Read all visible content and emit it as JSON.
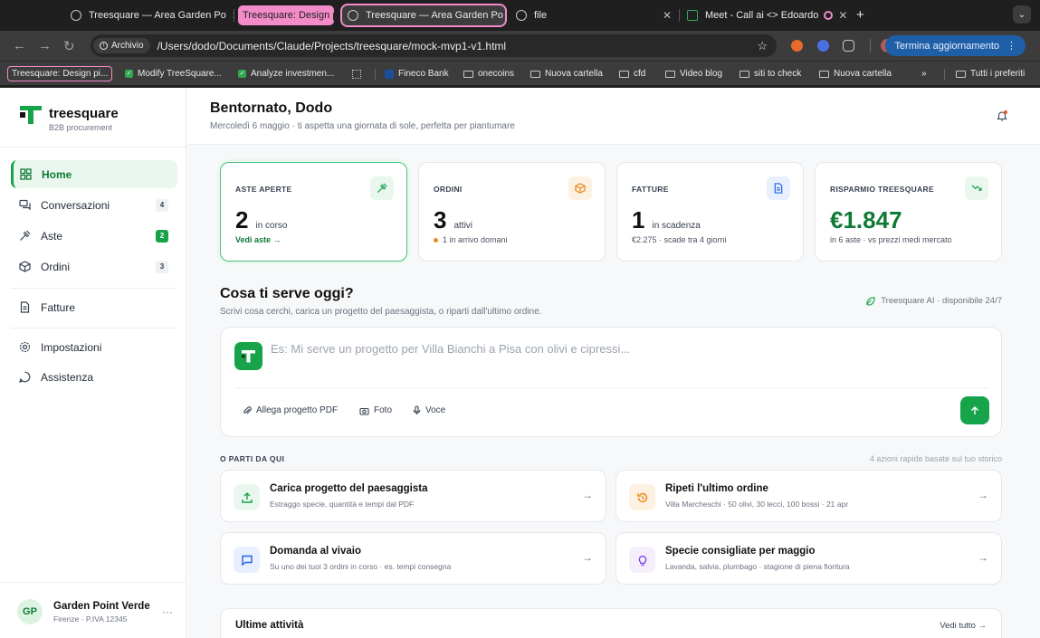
{
  "browser": {
    "tabs": [
      {
        "title": "Treesquare — Area Garden Po"
      },
      {
        "title": "Treesquare: Design p",
        "group": true
      },
      {
        "title": "Treesquare — Area Garden Po",
        "active": true
      },
      {
        "title": "file"
      },
      {
        "title": "Meet - Call ai <> Edoardo"
      }
    ],
    "url_chip": "Archivio",
    "url": "/Users/dodo/Documents/Claude/Projects/treesquare/mock-mvp1-v1.html",
    "update_label": "Termina aggiornamento",
    "bookmarks": [
      {
        "label": "Treesquare: Design pi...",
        "kind": "group"
      },
      {
        "label": "Modify TreeSquare...",
        "kind": "check"
      },
      {
        "label": "Analyze investmen...",
        "kind": "check"
      },
      {
        "label": "Fineco Bank",
        "kind": "site"
      },
      {
        "label": "onecoins",
        "kind": "folder"
      },
      {
        "label": "Nuova cartella",
        "kind": "folder"
      },
      {
        "label": "cfd",
        "kind": "folder"
      },
      {
        "label": "Video blog",
        "kind": "folder"
      },
      {
        "label": "siti to check",
        "kind": "folder"
      },
      {
        "label": "Nuova cartella",
        "kind": "folder"
      },
      {
        "label": "Tutti i preferiti",
        "kind": "folder"
      }
    ]
  },
  "sidebar": {
    "brand": "treesquare",
    "tagline": "B2B procurement",
    "items": [
      {
        "label": "Home",
        "icon": "grid-icon",
        "active": true
      },
      {
        "label": "Conversazioni",
        "icon": "chat-icon",
        "badge": "4"
      },
      {
        "label": "Aste",
        "icon": "gavel-icon",
        "badge": "2",
        "badge_green": true
      },
      {
        "label": "Ordini",
        "icon": "box-icon",
        "badge": "3"
      },
      {
        "label": "Fatture",
        "icon": "document-icon"
      },
      {
        "label": "Impostazioni",
        "icon": "gear-icon"
      },
      {
        "label": "Assistenza",
        "icon": "help-icon"
      }
    ],
    "user": {
      "initials": "GP",
      "name": "Garden Point Verde",
      "sub": "Firenze · P.IVA 12345"
    }
  },
  "header": {
    "title": "Bentornato, Dodo",
    "subtitle": "Mercoledì 6 maggio · ti aspetta una giornata di sole, perfetta per piantumare"
  },
  "stats": [
    {
      "label": "ASTE APERTE",
      "value": "2",
      "unit": "in corso",
      "foot": "Vedi aste →",
      "accent": "#16a34a"
    },
    {
      "label": "ORDINI",
      "value": "3",
      "unit": "attivi",
      "foot": "1 in arrivo domani",
      "accent": "#ea8a1a"
    },
    {
      "label": "FATTURE",
      "value": "1",
      "unit": "in scadenza",
      "foot": "€2.275 · scade tra 4 giorni",
      "accent": "#2563eb"
    },
    {
      "label": "RISPARMIO TREESQUARE",
      "value": "€1.847",
      "unit": "",
      "foot": "in 6 aste · vs prezzi medi mercato",
      "accent": "#16a34a"
    }
  ],
  "composer": {
    "title": "Cosa ti serve oggi?",
    "subtitle": "Scrivi cosa cerchi, carica un progetto del paesaggista, o riparti dall'ultimo ordine.",
    "ai_status": "Treesquare AI · disponibile 24/7",
    "placeholder": "Es: Mi serve un progetto per Villa Bianchi a Pisa con olivi e cipressi...",
    "attach_pdf": "Allega progetto PDF",
    "photo": "Foto",
    "voice": "Voce"
  },
  "quick": {
    "label": "O PARTI DA QUI",
    "note": "4 azioni rapide basate sul tuo storico",
    "items": [
      {
        "title": "Carica progetto del paesaggista",
        "sub": "Estraggo specie, quantità e tempi dal PDF",
        "icon": "upload-icon"
      },
      {
        "title": "Ripeti l'ultimo ordine",
        "sub": "Villa Marcheschi · 50 olivi, 30 lecci, 100 bossi · 21 apr",
        "icon": "history-icon"
      },
      {
        "title": "Domanda al vivaio",
        "sub": "Su uno dei tuoi 3 ordini in corso · es. tempi consegna",
        "icon": "message-icon"
      },
      {
        "title": "Specie consigliate per maggio",
        "sub": "Lavanda, salvia, plumbago · stagione di piena fioritura",
        "icon": "bulb-icon"
      }
    ]
  },
  "recent": {
    "title": "Ultime attività",
    "link": "Vedi tutto →"
  }
}
